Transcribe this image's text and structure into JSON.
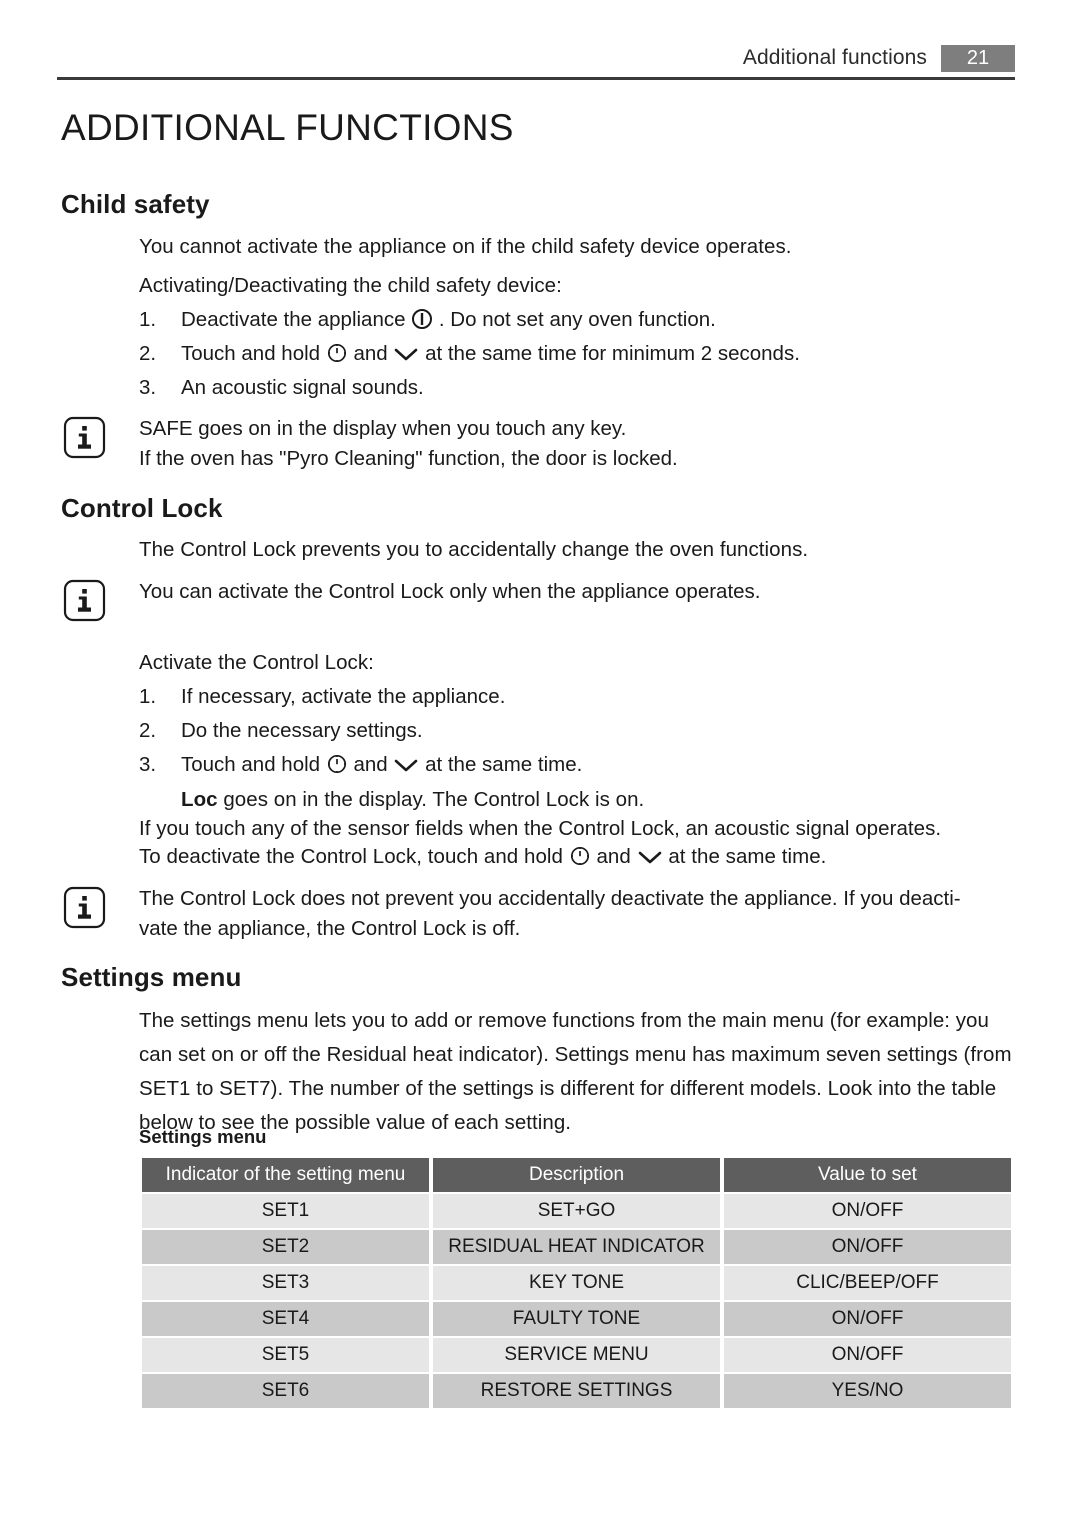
{
  "header": {
    "title": "Additional functions",
    "page_number": "21"
  },
  "doc_title": "ADDITIONAL FUNCTIONS",
  "sections": {
    "child_safety": {
      "heading": "Child safety",
      "intro": "You cannot activate the appliance on if the child safety device operates.",
      "subintro": "Activating/Deactivating the child safety device:",
      "steps": [
        {
          "num": "1.",
          "before": "Deactivate the appliance ",
          "icon1": "power-icon",
          "after": " . Do not set any oven function."
        },
        {
          "num": "2.",
          "before": "Touch and hold ",
          "icon1": "clock-icon",
          "middle": " and ",
          "icon2": "chevron-down-icon",
          "after": " at the same time for minimum 2 seconds."
        },
        {
          "num": "3.",
          "before": "An acoustic signal sounds.",
          "after": ""
        }
      ],
      "note": {
        "icon": "info-icon",
        "line1": "SAFE goes on in the display when you touch any key.",
        "line2": "If the oven has \"Pyro Cleaning\" function, the door is locked."
      }
    },
    "control_lock": {
      "heading": "Control Lock",
      "intro": "The Control Lock prevents you to accidentally change the oven functions.",
      "note1": {
        "icon": "info-icon",
        "line1": "You can activate the Control Lock only when the appliance operates."
      },
      "activate_label": "Activate the Control Lock:",
      "steps": [
        {
          "num": "1.",
          "before": "If necessary, activate the appliance.",
          "after": ""
        },
        {
          "num": "2.",
          "before": "Do the necessary settings.",
          "after": ""
        },
        {
          "num": "3.",
          "before": "Touch and hold ",
          "icon1": "clock-icon",
          "middle": " and ",
          "icon2": "chevron-down-icon",
          "after": " at the same time."
        }
      ],
      "loc_bold": "Loc",
      "loc_rest": " goes on in the display. The Control Lock is on.",
      "para1": "If you touch any of the sensor fields when the Control Lock, an acoustic signal operates.",
      "para2_before": "To deactivate the Control Lock, touch and hold ",
      "para2_middle": " and ",
      "para2_after": " at the same time.",
      "note2": {
        "icon": "info-icon",
        "line1": "The Control Lock does not prevent you accidentally deactivate the appliance. If you deacti-",
        "line2": "vate the appliance, the Control Lock is off."
      }
    },
    "settings_menu": {
      "heading": "Settings menu",
      "paragraph": "The settings menu lets you to add or remove functions from the main menu (for example: you can set on or off the Residual heat indicator). Settings menu has maximum seven settings (from SET1 to SET7). The number of the settings is different for different models. Look into the table below to see the possible value of each setting.",
      "table_caption": "Settings menu",
      "table": {
        "columns": [
          "Indicator of the setting menu",
          "Description",
          "Value to set"
        ],
        "rows": [
          [
            "SET1",
            "SET+GO",
            "ON/OFF"
          ],
          [
            "SET2",
            "RESIDUAL HEAT INDICATOR",
            "ON/OFF"
          ],
          [
            "SET3",
            "KEY TONE",
            "CLIC/BEEP/OFF"
          ],
          [
            "SET4",
            "FAULTY TONE",
            "ON/OFF"
          ],
          [
            "SET5",
            "SERVICE MENU",
            "ON/OFF"
          ],
          [
            "SET6",
            "RESTORE SETTINGS",
            "YES/NO"
          ]
        ]
      }
    }
  },
  "colors": {
    "header_badge": "#7e7e7e",
    "table_header": "#5e5e5e",
    "row_light": "#e6e6e6",
    "row_dark": "#c9c9c9",
    "text": "#1a1a1a"
  }
}
